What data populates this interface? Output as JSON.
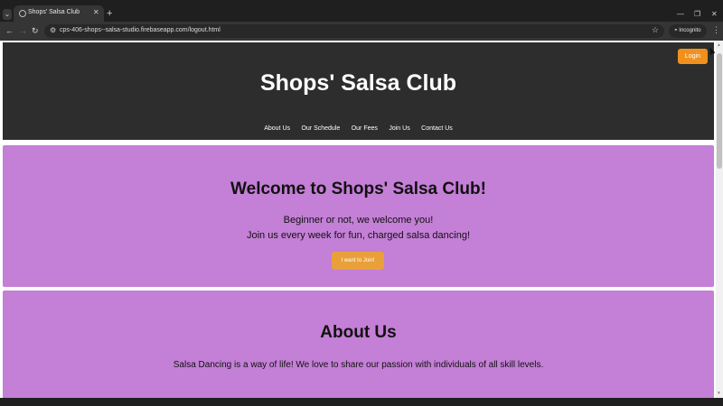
{
  "browser": {
    "tab_title": "Shops' Salsa Club",
    "new_tab_icon": "plus-icon",
    "url": "cps-406-shops--salsa-studio.firebaseapp.com/logout.html",
    "incognito_label": "Incognito"
  },
  "site": {
    "login_label": "Login",
    "title": "Shops' Salsa Club",
    "nav": [
      {
        "label": "About Us"
      },
      {
        "label": "Our Schedule"
      },
      {
        "label": "Our Fees"
      },
      {
        "label": "Join Us"
      },
      {
        "label": "Contact Us"
      }
    ]
  },
  "hero": {
    "title": "Welcome to Shops' Salsa Club!",
    "line1": "Beginner or not, we welcome you!",
    "line2": "Join us every week for fun, charged salsa dancing!",
    "join_label": "I want to Join!"
  },
  "about": {
    "title": "About Us",
    "text": "Salsa Dancing is a way of life! We love to share our passion with individuals of all skill levels."
  },
  "colors": {
    "header_bg": "#2d2d2d",
    "section_bg": "#c47fd6",
    "accent": "#f0911d"
  }
}
